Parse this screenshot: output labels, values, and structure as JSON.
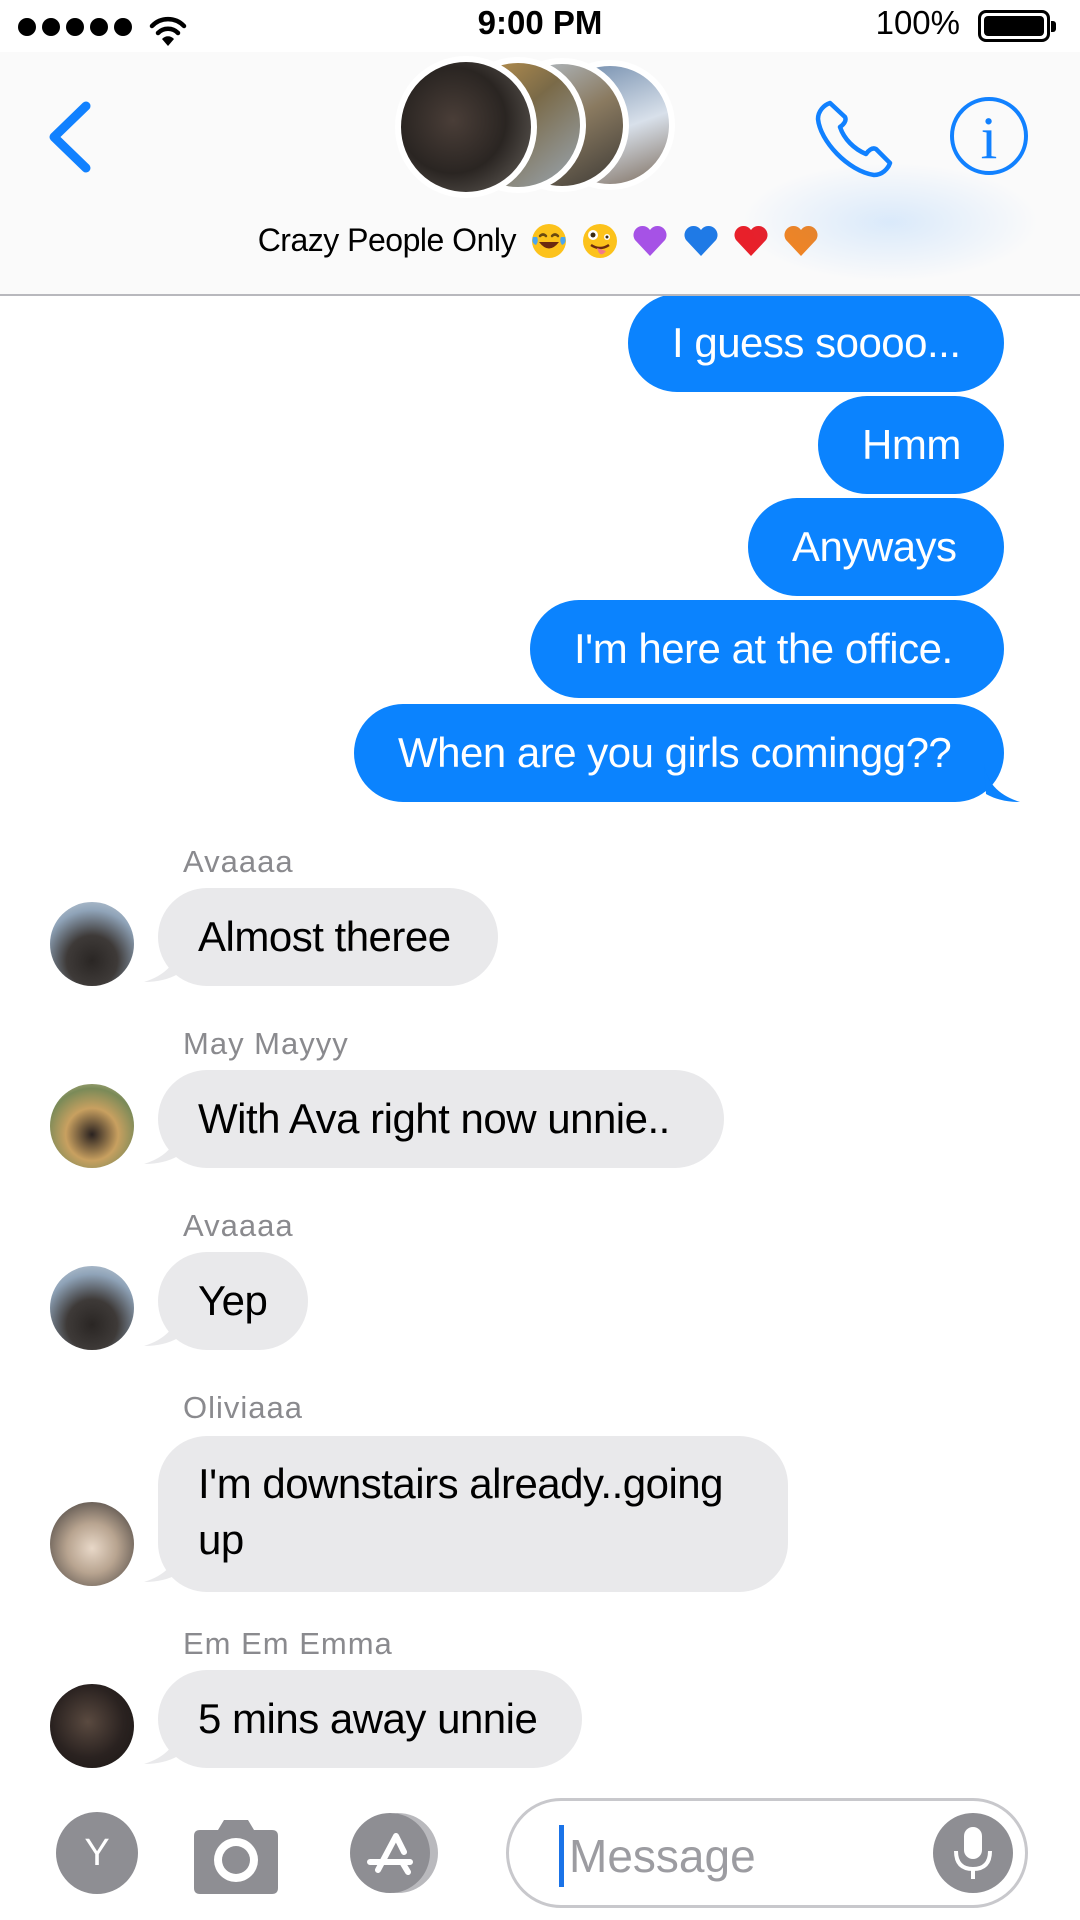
{
  "status_bar": {
    "time": "9:00 PM",
    "battery_percent": "100%",
    "signal_bars": 5,
    "battery_level": 1.0
  },
  "header": {
    "back_icon": "chevron-left-icon",
    "group_name": "Crazy People Only",
    "group_emojis": [
      "😂",
      "🤪",
      "💜",
      "💙",
      "❤️",
      "🧡"
    ],
    "call_icon": "phone-icon",
    "info_icon": "info-icon"
  },
  "messages": {
    "outgoing": [
      {
        "text": "I guess soooo..."
      },
      {
        "text": "Hmm"
      },
      {
        "text": "Anyways"
      },
      {
        "text": "I'm here at the office."
      },
      {
        "text": "When are you girls comingg??"
      }
    ],
    "incoming": [
      {
        "sender": "Avaaaa",
        "text": "Almost theree"
      },
      {
        "sender": "May Mayyy",
        "text": "With Ava right now unnie.."
      },
      {
        "sender": "Avaaaa",
        "text": "Yep"
      },
      {
        "sender": "Oliviaaa",
        "text": "I'm downstairs already..going up"
      },
      {
        "sender": "Em Em Emma",
        "text": "5 mins away unnie"
      }
    ]
  },
  "input_bar": {
    "avatar_letter": "Y",
    "camera_icon": "camera-icon",
    "apps_icon": "app-store-icon",
    "placeholder": "Message",
    "mic_icon": "microphone-icon"
  },
  "colors": {
    "accent": "#0b83fe",
    "incoming_bubble": "#e9e9eb",
    "sender_label": "#8a8a8e",
    "icon_gray": "#8e8e93"
  }
}
